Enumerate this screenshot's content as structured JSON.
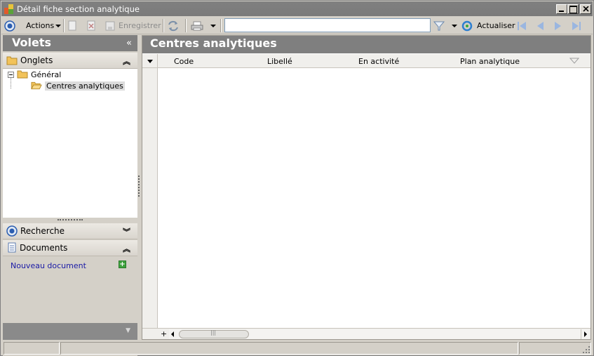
{
  "window": {
    "title": "Détail fiche section analytique"
  },
  "toolbar": {
    "actions_label": "Actions",
    "save_label": "Enregistrer",
    "search_value": "",
    "refresh_label": "Actualiser",
    "icons": [
      "actions-icon",
      "new-icon",
      "delete-icon",
      "save-icon",
      "sync-icon",
      "print-icon",
      "filter-icon",
      "refresh-icon",
      "first-icon",
      "previous-icon",
      "next-icon",
      "last-icon"
    ]
  },
  "left_panel": {
    "title": "Volets",
    "onglets": {
      "label": "Onglets",
      "tree": [
        {
          "label": "Général"
        },
        {
          "label": "Centres analytiques"
        }
      ]
    },
    "recherche": {
      "label": "Recherche"
    },
    "documents": {
      "label": "Documents",
      "new_document_label": "Nouveau document"
    }
  },
  "main": {
    "title": "Centres analytiques",
    "columns": [
      "Code",
      "Libellé",
      "En activité",
      "Plan analytique"
    ],
    "rows": [],
    "add_row_label": "+"
  },
  "colors": {
    "header_gray": "#7f7f7f",
    "window_bg": "#d4d0c8",
    "link_blue": "#1a1aa6"
  }
}
